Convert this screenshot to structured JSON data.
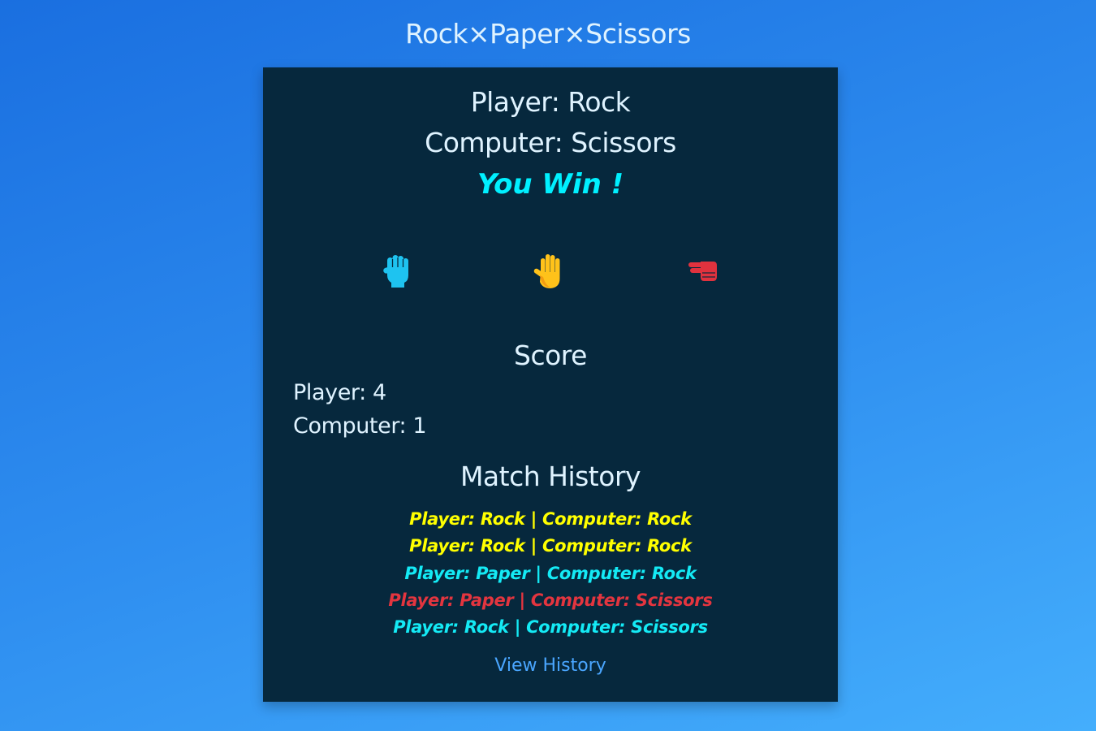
{
  "app": {
    "title": "Rock×Paper×Scissors"
  },
  "round": {
    "player_text": "Player: Rock",
    "computer_text": "Computer: Scissors",
    "result_text": "You Win !",
    "result_color": "#00f0ff"
  },
  "choices": [
    {
      "name": "rock",
      "icon": "fist-icon",
      "color": "#1ec3f0"
    },
    {
      "name": "paper",
      "icon": "raised-hand-icon",
      "color": "#ffc21a"
    },
    {
      "name": "scissors",
      "icon": "peace-hand-icon",
      "color": "#e0323e"
    }
  ],
  "score": {
    "heading": "Score",
    "player_text": "Player: 4",
    "computer_text": "Computer: 1"
  },
  "history": {
    "heading": "Match History",
    "entries": [
      {
        "text": "Player: Rock | Computer: Rock",
        "outcome": "tie",
        "color": "#ffff00"
      },
      {
        "text": "Player: Rock | Computer: Rock",
        "outcome": "tie",
        "color": "#ffff00"
      },
      {
        "text": "Player: Paper | Computer: Rock",
        "outcome": "win",
        "color": "#14eaf5"
      },
      {
        "text": "Player: Paper | Computer: Scissors",
        "outcome": "loss",
        "color": "#e3353f"
      },
      {
        "text": "Player: Rock | Computer: Scissors",
        "outcome": "win",
        "color": "#14eaf5"
      }
    ],
    "view_link": "View History"
  }
}
